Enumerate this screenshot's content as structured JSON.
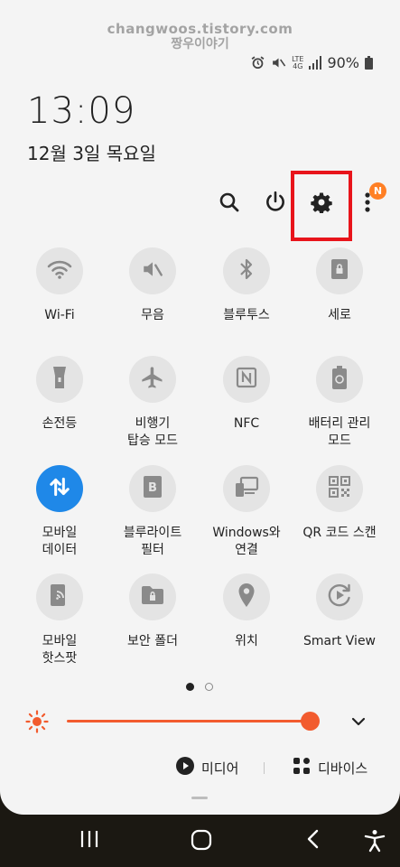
{
  "watermark": {
    "line1": "changwoos.tistory.com",
    "line2": "짱우이야기"
  },
  "status_bar": {
    "network": "LTE",
    "network_sub": "4G",
    "battery": "90%"
  },
  "clock": {
    "time": "13:09",
    "date": "12월 3일 목요일"
  },
  "toolbar": {
    "notification_badge": "N"
  },
  "tiles": [
    {
      "label": "Wi-Fi",
      "icon": "wifi-icon"
    },
    {
      "label": "무음",
      "icon": "mute-icon"
    },
    {
      "label": "블루투스",
      "icon": "bluetooth-icon"
    },
    {
      "label": "세로",
      "icon": "portrait-lock-icon"
    },
    {
      "label": "손전등",
      "icon": "flashlight-icon"
    },
    {
      "label": "비행기\n탑승 모드",
      "icon": "airplane-icon"
    },
    {
      "label": "NFC",
      "icon": "nfc-icon"
    },
    {
      "label": "배터리 관리\n모드",
      "icon": "battery-saver-icon"
    },
    {
      "label": "모바일\n데이터",
      "icon": "mobile-data-icon"
    },
    {
      "label": "블루라이트\n필터",
      "icon": "blue-light-icon"
    },
    {
      "label": "Windows와\n연결",
      "icon": "link-to-windows-icon"
    },
    {
      "label": "QR 코드 스캔",
      "icon": "qr-code-icon"
    },
    {
      "label": "모바일\n핫스팟",
      "icon": "hotspot-icon"
    },
    {
      "label": "보안 폴더",
      "icon": "secure-folder-icon"
    },
    {
      "label": "위치",
      "icon": "location-icon"
    },
    {
      "label": "Smart View",
      "icon": "smart-view-icon"
    }
  ],
  "brightness": {
    "level": 0.95
  },
  "media_bar": {
    "media_label": "미디어",
    "devices_label": "디바이스"
  },
  "colors": {
    "accent": "#1f88e8",
    "slider": "#f25b2e",
    "highlight": "#e8141b",
    "badge": "#ff7f24"
  }
}
